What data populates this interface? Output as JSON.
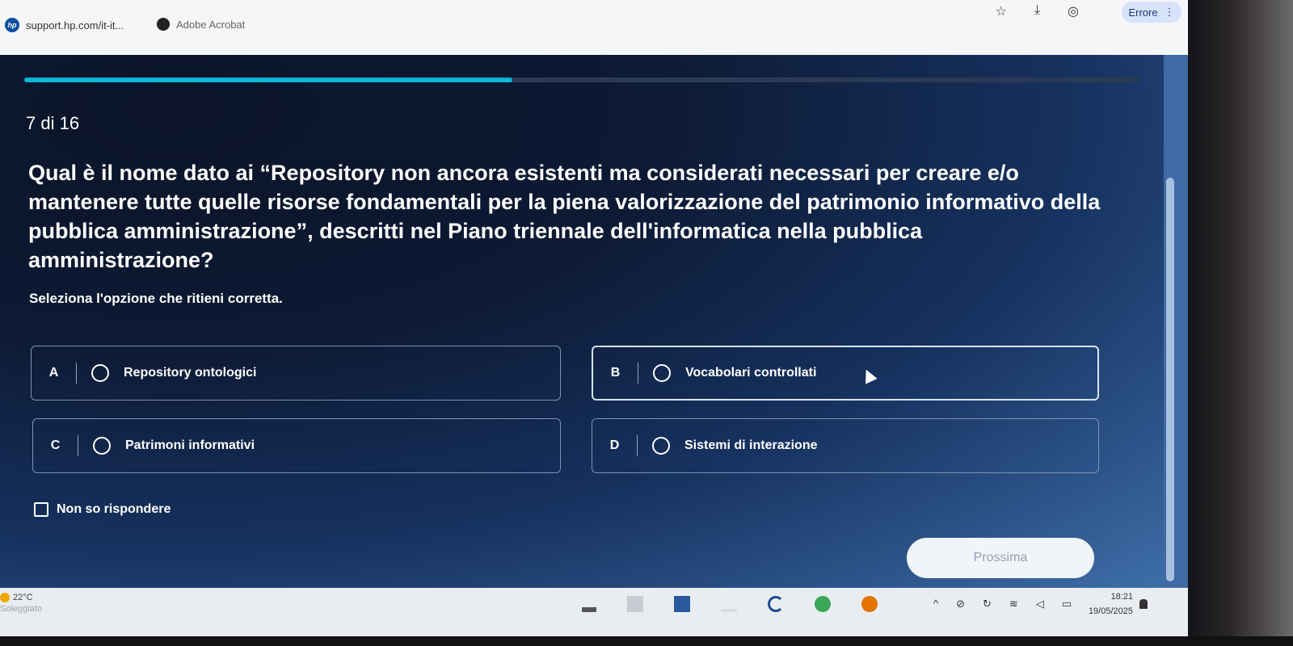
{
  "browser": {
    "bookmarks": [
      {
        "label": "support.hp.com/it-it...",
        "icon": "hp-logo-icon"
      },
      {
        "label": "Adobe Acrobat",
        "icon": "acrobat-icon"
      }
    ],
    "error_button": "Errore",
    "icons": [
      "star-icon",
      "download-icon",
      "profile-icon",
      "menu-dots-icon"
    ]
  },
  "quiz": {
    "progress": 0.4375,
    "counter": "7 di 16",
    "question": "Qual è il nome dato ai “Repository non ancora esistenti ma considerati necessari per creare e/o mantenere tutte quelle risorse fondamentali per la piena valorizzazione del patrimonio informativo della pubblica amministrazione”, descritti nel Piano triennale dell'informatica nella pubblica amministrazione?",
    "instruction": "Seleziona l'opzione che ritieni corretta.",
    "options": [
      {
        "letter": "A",
        "text": "Repository ontologici"
      },
      {
        "letter": "B",
        "text": "Vocabolari controllati"
      },
      {
        "letter": "C",
        "text": "Patrimoni informativi"
      },
      {
        "letter": "D",
        "text": "Sistemi di interazione"
      }
    ],
    "no_answer": "Non so rispondere",
    "next_button": "Prossima"
  },
  "taskbar": {
    "temperature": "22°C",
    "condition": "Soleggiato",
    "time": "18:21",
    "date": "19/05/2025"
  },
  "colors": {
    "accent": "#0ab4d8",
    "background": "#163260"
  }
}
